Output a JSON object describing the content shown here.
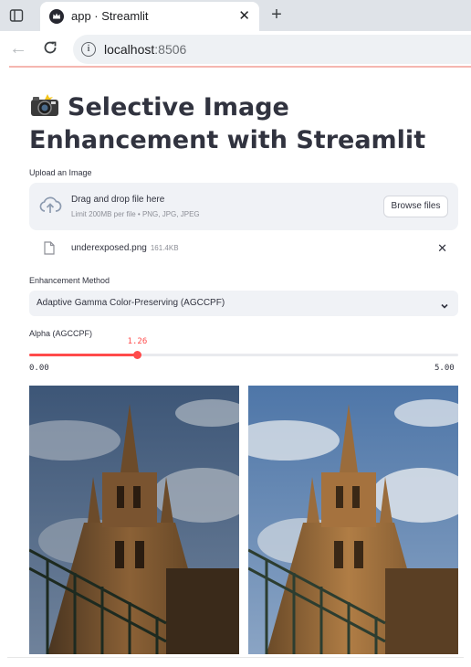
{
  "browser": {
    "tab_title": "app · Streamlit",
    "url_host": "localhost",
    "url_port": ":8506"
  },
  "page": {
    "title": "Selective Image Enhancement with Streamlit",
    "uploader": {
      "label": "Upload an Image",
      "drop_text": "Drag and drop file here",
      "limit_text": "Limit 200MB per file • PNG, JPG, JPEG",
      "browse_label": "Browse files",
      "file_name": "underexposed.png",
      "file_size": "161.4KB"
    },
    "method": {
      "label": "Enhancement Method",
      "selected": "Adaptive Gamma Color-Preserving (AGCCPF)"
    },
    "alpha_slider": {
      "label": "Alpha (AGCCPF)",
      "value": 1.26,
      "value_text": "1.26",
      "min": 0,
      "max": 5,
      "min_text": "0.00",
      "max_text": "5.00"
    },
    "images": [
      {
        "name": "original-image",
        "tone": "dark"
      },
      {
        "name": "enhanced-image",
        "tone": "bright"
      }
    ]
  },
  "colors": {
    "accent": "#ff4b4b",
    "text": "#31333f",
    "widget_bg": "#f0f2f6"
  }
}
